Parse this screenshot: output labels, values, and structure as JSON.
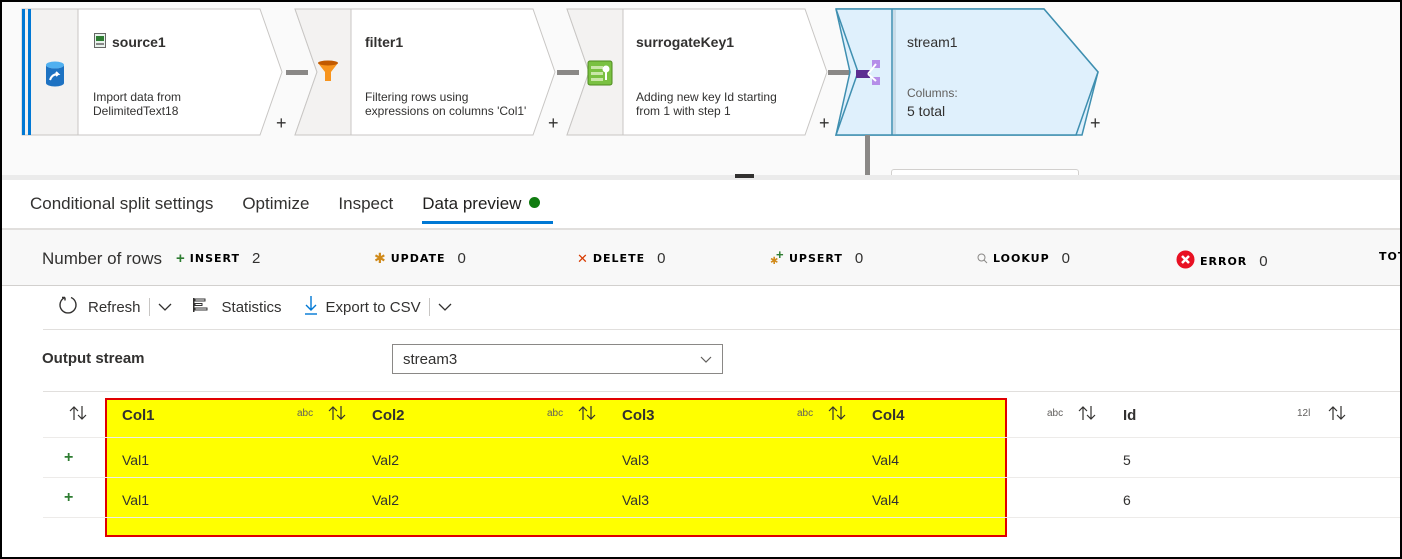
{
  "pipeline": {
    "nodes": [
      {
        "name": "source1",
        "icon": "database-source-icon",
        "file_icon": "csv-file-icon",
        "description": [
          "Import data from",
          "DelimitedText18"
        ]
      },
      {
        "name": "filter1",
        "icon": "filter-funnel-icon",
        "description": [
          "Filtering rows using",
          "expressions on columns 'Col1'"
        ]
      },
      {
        "name": "surrogateKey1",
        "icon": "surrogate-key-icon",
        "description": [
          "Adding new key Id starting",
          "from 1 with step 1"
        ]
      },
      {
        "name": "stream1",
        "icon": "conditional-split-icon",
        "columns_label": "Columns:",
        "columns_value": "5 total",
        "selected": true
      }
    ],
    "add_label": "+"
  },
  "tabs": [
    {
      "label": "Conditional split settings",
      "active": false
    },
    {
      "label": "Optimize",
      "active": false
    },
    {
      "label": "Inspect",
      "active": false
    },
    {
      "label": "Data preview",
      "active": true,
      "status": "green-dot"
    }
  ],
  "row_counts": {
    "label": "Number of rows",
    "items": [
      {
        "key": "INSERT",
        "value": "2",
        "icon": "plus-icon",
        "color": "#2e7d32"
      },
      {
        "key": "UPDATE",
        "value": "0",
        "icon": "asterisk-icon",
        "color": "#d08a1a"
      },
      {
        "key": "DELETE",
        "value": "0",
        "icon": "x-icon",
        "color": "#d83b01"
      },
      {
        "key": "UPSERT",
        "value": "0",
        "icon": "upsert-icon",
        "color": "#2e7d32"
      },
      {
        "key": "LOOKUP",
        "value": "0",
        "icon": "search-icon",
        "color": "#8a8886"
      },
      {
        "key": "ERROR",
        "value": "0",
        "icon": "error-icon",
        "color": "#e81123"
      },
      {
        "key": "TOT",
        "value": ""
      }
    ]
  },
  "toolbar": {
    "refresh": "Refresh",
    "statistics": "Statistics",
    "export": "Export to CSV"
  },
  "output_stream": {
    "label": "Output stream",
    "selected": "stream3"
  },
  "table": {
    "columns": [
      {
        "name": "Col1",
        "type": "abc"
      },
      {
        "name": "Col2",
        "type": "abc"
      },
      {
        "name": "Col3",
        "type": "abc"
      },
      {
        "name": "Col4",
        "type": "abc"
      },
      {
        "name": "Id",
        "type": "12l"
      }
    ],
    "rows": [
      {
        "marker": "+",
        "cells": [
          "Val1",
          "Val2",
          "Val3",
          "Val4",
          "5"
        ]
      },
      {
        "marker": "+",
        "cells": [
          "Val1",
          "Val2",
          "Val3",
          "Val4",
          "6"
        ]
      }
    ]
  },
  "colors": {
    "accent": "#0078d4",
    "highlight_fill": "#ffff00",
    "highlight_border": "#e00000",
    "selected_node": "#dff0fc"
  }
}
